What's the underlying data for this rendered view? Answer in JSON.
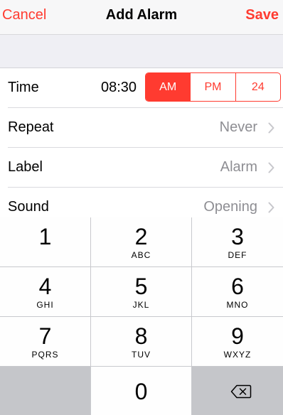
{
  "navbar": {
    "cancel_label": "Cancel",
    "title": "Add Alarm",
    "save_label": "Save"
  },
  "rows": {
    "time": {
      "label": "Time",
      "value": "08:30",
      "segments": [
        "AM",
        "PM",
        "24"
      ],
      "selected": "AM"
    },
    "repeat": {
      "label": "Repeat",
      "value": "Never"
    },
    "label": {
      "label": "Label",
      "value": "Alarm"
    },
    "sound": {
      "label": "Sound",
      "value": "Opening"
    }
  },
  "keypad": {
    "keys": [
      {
        "digit": "1",
        "letters": ""
      },
      {
        "digit": "2",
        "letters": "ABC"
      },
      {
        "digit": "3",
        "letters": "DEF"
      },
      {
        "digit": "4",
        "letters": "GHI"
      },
      {
        "digit": "5",
        "letters": "JKL"
      },
      {
        "digit": "6",
        "letters": "MNO"
      },
      {
        "digit": "7",
        "letters": "PQRS"
      },
      {
        "digit": "8",
        "letters": "TUV"
      },
      {
        "digit": "9",
        "letters": "WXYZ"
      },
      {
        "digit": "0",
        "letters": ""
      }
    ],
    "backspace_icon": "backspace-icon"
  },
  "colors": {
    "accent": "#ff3b30",
    "secondary_text": "#8e8e93",
    "keypad_bg": "#c8c9cd"
  }
}
